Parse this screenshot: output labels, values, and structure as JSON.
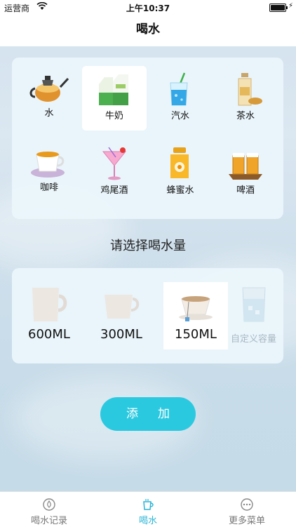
{
  "status_bar": {
    "carrier": "运营商",
    "time": "上午10:37"
  },
  "nav": {
    "title": "喝水"
  },
  "drinks": [
    {
      "label": "水",
      "icon": "teapot-icon",
      "selected": false
    },
    {
      "label": "牛奶",
      "icon": "milk-carton-icon",
      "selected": true
    },
    {
      "label": "汽水",
      "icon": "soda-glass-icon",
      "selected": false
    },
    {
      "label": "茶水",
      "icon": "tea-bottle-icon",
      "selected": false
    },
    {
      "label": "咖啡",
      "icon": "coffee-cup-icon",
      "selected": false
    },
    {
      "label": "鸡尾酒",
      "icon": "cocktail-icon",
      "selected": false
    },
    {
      "label": "蜂蜜水",
      "icon": "honey-jar-icon",
      "selected": false
    },
    {
      "label": "啤酒",
      "icon": "beer-mugs-icon",
      "selected": false
    }
  ],
  "prompt": "请选择喝水量",
  "volumes": [
    {
      "label": "600ML",
      "icon": "large-mug-icon",
      "selected": false
    },
    {
      "label": "300ML",
      "icon": "medium-cup-icon",
      "selected": false
    },
    {
      "label": "150ML",
      "icon": "teacup-icon",
      "selected": true
    },
    {
      "label": "自定义容量",
      "icon": "custom-glass-icon",
      "selected": false
    }
  ],
  "add_button": "添加",
  "tabs": [
    {
      "label": "喝水记录",
      "icon": "drop-record-icon",
      "active": false
    },
    {
      "label": "喝水",
      "icon": "cup-icon",
      "active": true
    },
    {
      "label": "更多菜单",
      "icon": "more-dots-icon",
      "active": false
    }
  ],
  "colors": {
    "accent": "#2bc9e0",
    "tab_active": "#2ab5d6"
  }
}
